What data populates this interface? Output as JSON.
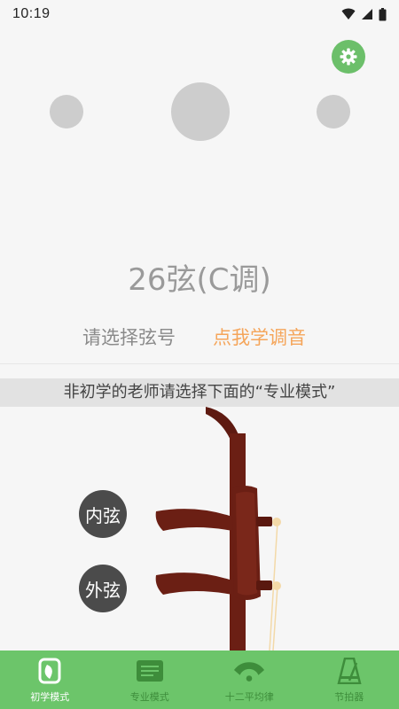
{
  "status_bar": {
    "time": "10:19"
  },
  "tuner": {
    "note_label": "26弦(C调)",
    "select_string_label": "请选择弦号",
    "learn_tuning_link": "点我学调音",
    "notice": "非初学的老师请选择下面的“专业模式”",
    "inner_string_label": "内弦",
    "outer_string_label": "外弦"
  },
  "tabs": [
    {
      "label": "初学模式",
      "icon": "leaf-doc-icon",
      "active": true
    },
    {
      "label": "专业模式",
      "icon": "note-card-icon",
      "active": false
    },
    {
      "label": "十二平均律",
      "icon": "fan-gauge-icon",
      "active": false
    },
    {
      "label": "节拍器",
      "icon": "metronome-icon",
      "active": false
    }
  ],
  "colors": {
    "accent_green": "#6cc56a",
    "link_orange": "#f5a55a",
    "erhu_brown": "#6b1f14",
    "circle_gray": "#cdcdcd"
  }
}
